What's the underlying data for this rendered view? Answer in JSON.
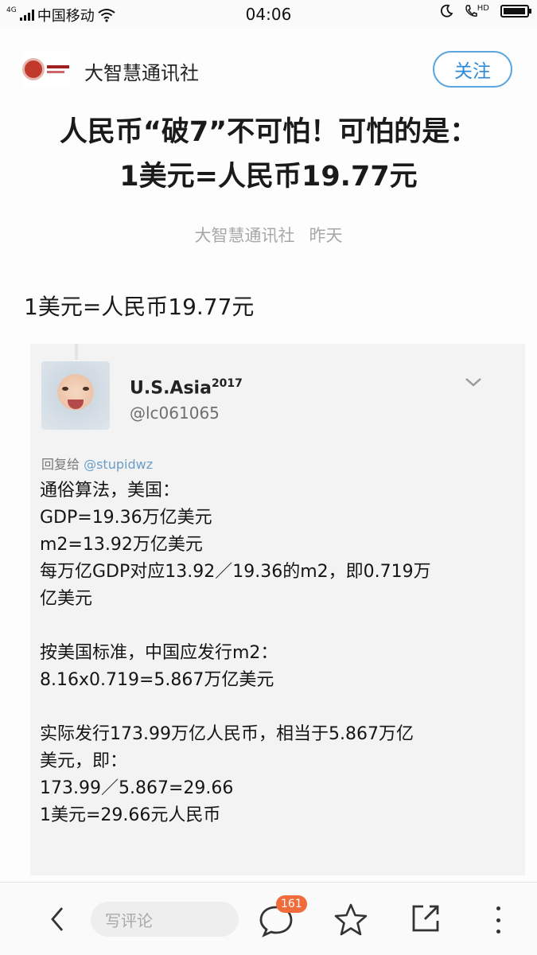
{
  "status_bar": {
    "network_type": "4G",
    "carrier": "中国移动",
    "time": "04:06",
    "hd_label": "HD",
    "battery_level": 0.95,
    "icons": [
      "signal-icon",
      "wifi-icon",
      "moon-icon",
      "hd-call-icon",
      "battery-icon"
    ]
  },
  "account": {
    "name": "大智慧通讯社",
    "follow_label": "关注",
    "accent_color": "#2e8ad6"
  },
  "article": {
    "title_line1": "人民币“破7”不可怕！可怕的是：",
    "title_line2": "1美元=人民币19.77元",
    "meta_author": "大智慧通讯社",
    "meta_date": "昨天",
    "lead": "1美元=人民币19.77元"
  },
  "tweet": {
    "display_name": "U.S.Asia",
    "display_name_suffix": "2017",
    "handle": "@lc061065",
    "reply_prefix": "回复给 ",
    "reply_mention": "@stupidwz",
    "body": {
      "p1": "通俗算法，美国：",
      "p2": "GDP=19.36万亿美元",
      "p3": "m2=13.92万亿美元",
      "p4": "每万亿GDP对应13.92／19.36的m2，即0.719万",
      "p5": "亿美元",
      "p6": "按美国标准，中国应发行m2：",
      "p7": "8.16x0.719=5.867万亿美元",
      "p8": "实际发行173.99万亿人民币，相当于5.867万亿",
      "p9": "美元，即：",
      "p10": "173.99／5.867=29.66",
      "p11": "1美元=29.66元人民币"
    }
  },
  "bottom_bar": {
    "comment_placeholder": "写评论",
    "comment_count": "161",
    "badge_color": "#f26b3a",
    "icons": [
      "back-icon",
      "comment-icon",
      "star-icon",
      "share-icon",
      "more-icon"
    ]
  }
}
